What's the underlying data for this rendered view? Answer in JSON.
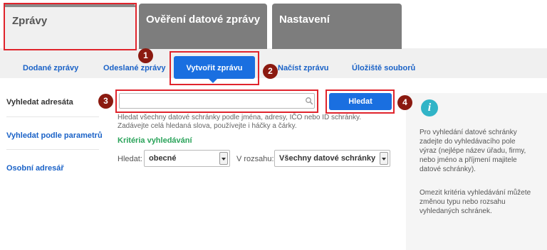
{
  "tabs": [
    {
      "label": "Zprávy",
      "active": true
    },
    {
      "label": "Ověření datové zprávy",
      "active": false
    },
    {
      "label": "Nastavení",
      "active": false
    }
  ],
  "subnav": {
    "items": [
      {
        "label": "Dodané zprávy"
      },
      {
        "label": "Odeslané zprávy"
      },
      {
        "label": "Vytvořit zprávu",
        "active": true
      },
      {
        "label": "Načíst zprávu"
      },
      {
        "label": "Úložiště souborů"
      }
    ]
  },
  "leftmenu": {
    "items": [
      {
        "label": "Vyhledat adresáta",
        "active": true
      },
      {
        "label": "Vyhledat podle parametrů"
      },
      {
        "label": "Osobní adresář"
      }
    ]
  },
  "search": {
    "value": "",
    "placeholder": "",
    "button_label": "Hledat",
    "hint": "Hledat všechny datové schránky podle jména, adresy, IČO nebo ID schránky. Zadávejte celá hledaná slova, používejte i háčky a čárky.",
    "criteria_heading": "Kritéria vyhledávání",
    "hledat_label": "Hledat:",
    "hledat_value": "obecné",
    "rozsah_label": "V rozsahu:",
    "rozsah_value": "Všechny datové schránky"
  },
  "info": {
    "paragraph1": "Pro vyhledání datové schránky zadejte do vyhledávacího pole výraz (nejlépe název úřadu, firmy, nebo jméno a příjmení majitele datové schránky).",
    "paragraph2": "Omezit kritéria vyhledávání můžete změnou typu nebo rozsahu vyhledaných schránek."
  },
  "annotations": [
    "1",
    "2",
    "3",
    "4"
  ],
  "colors": {
    "accent": "#1a6fe0",
    "link": "#1a62c7",
    "criteria": "#2aa35a",
    "annotation_frame": "#e0242c",
    "annotation_badge": "#8b1a10",
    "info_icon": "#31b4c7"
  }
}
